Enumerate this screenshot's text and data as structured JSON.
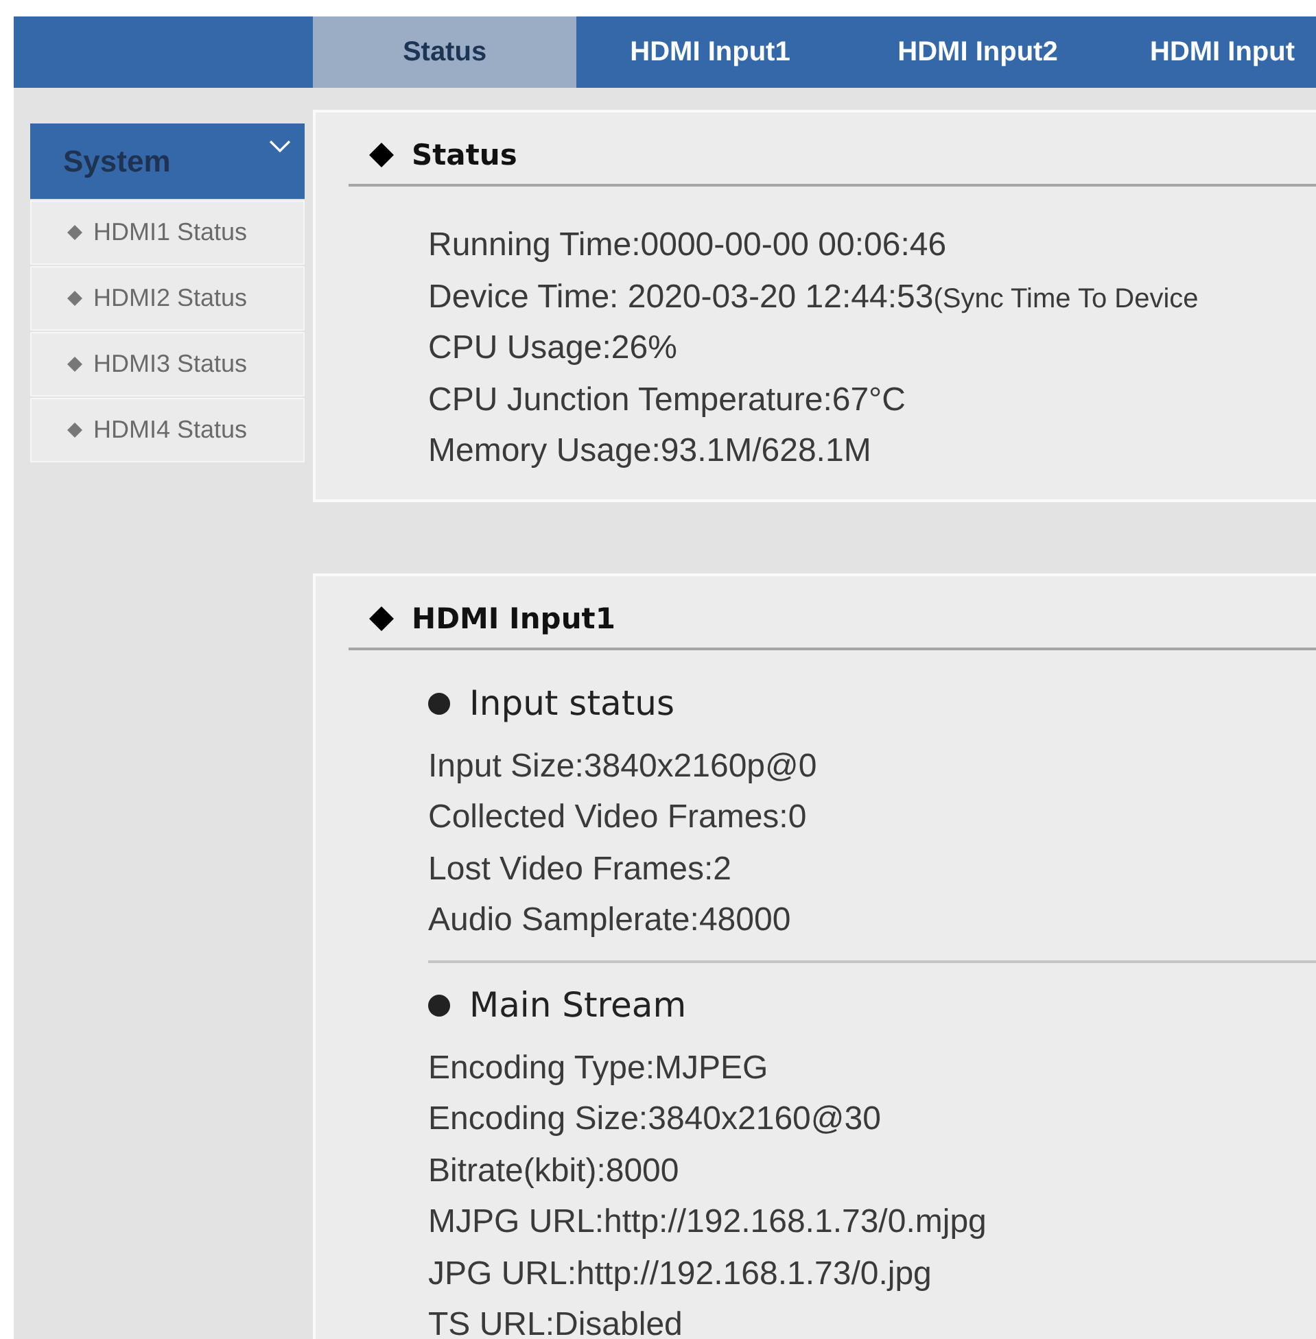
{
  "tabs": [
    {
      "label": "Status",
      "selected": true
    },
    {
      "label": "HDMI Input1",
      "selected": false
    },
    {
      "label": "HDMI Input2",
      "selected": false
    },
    {
      "label": "HDMI Input",
      "selected": false
    }
  ],
  "sidebar": {
    "header": "System",
    "expanded": true,
    "items": [
      {
        "label": "HDMI1 Status"
      },
      {
        "label": "HDMI2 Status"
      },
      {
        "label": "HDMI3 Status"
      },
      {
        "label": "HDMI4 Status"
      }
    ]
  },
  "sections": [
    {
      "title": "Status",
      "groups": [
        {
          "lines": [
            {
              "text": "Running Time:0000-00-00 00:06:46"
            },
            {
              "text": "Device Time: 2020-03-20 12:44:53",
              "link": "(Sync Time To Device"
            },
            {
              "text": "CPU Usage:26%"
            },
            {
              "text": "CPU Junction Temperature:67°C"
            },
            {
              "text": "Memory Usage:93.1M/628.1M"
            }
          ]
        }
      ]
    },
    {
      "title": "HDMI Input1",
      "groups": [
        {
          "title": "Input status",
          "lines": [
            {
              "text": "Input Size:3840x2160p@0"
            },
            {
              "text": "Collected Video Frames:0"
            },
            {
              "text": "Lost Video Frames:2"
            },
            {
              "text": "Audio Samplerate:48000"
            }
          ]
        },
        {
          "title": "Main Stream",
          "lines": [
            {
              "text": "Encoding Type:MJPEG"
            },
            {
              "text": "Encoding Size:3840x2160@30"
            },
            {
              "text": "Bitrate(kbit):8000"
            },
            {
              "text": "MJPG URL:http://192.168.1.73/0.mjpg"
            },
            {
              "text": "JPG URL:http://192.168.1.73/0.jpg"
            },
            {
              "text": "TS URL:Disabled"
            }
          ]
        }
      ]
    }
  ]
}
